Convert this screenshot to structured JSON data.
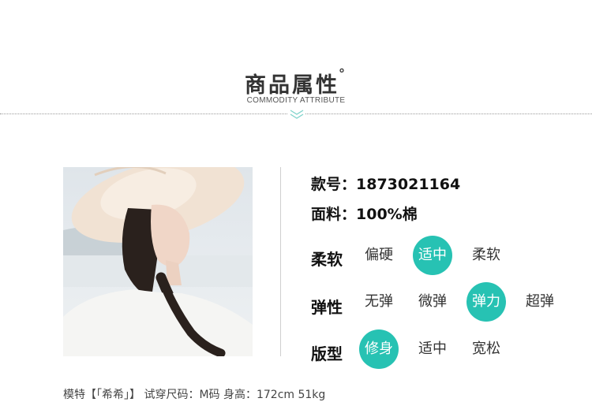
{
  "header": {
    "title": "商品属性",
    "title_mark": "°",
    "subtitle": "COMMODITY ATTRIBUTE"
  },
  "info": {
    "style_no_label": "款号：",
    "style_no_value": "1873021164",
    "fabric_label": "面料：",
    "fabric_value": "100%棉"
  },
  "attributes": [
    {
      "label": "柔软",
      "options": [
        "偏硬",
        "适中",
        "柔软"
      ],
      "selected": "适中"
    },
    {
      "label": "弹性",
      "options": [
        "无弹",
        "微弹",
        "弹力",
        "超弹"
      ],
      "selected": "弹力"
    },
    {
      "label": "版型",
      "options": [
        "修身",
        "适中",
        "宽松"
      ],
      "selected": "修身"
    }
  ],
  "footer": {
    "text": "模特【「希希」】 试穿尺码：M码 身高：172cm 51kg"
  },
  "colors": {
    "accent": "#27c2b3"
  }
}
